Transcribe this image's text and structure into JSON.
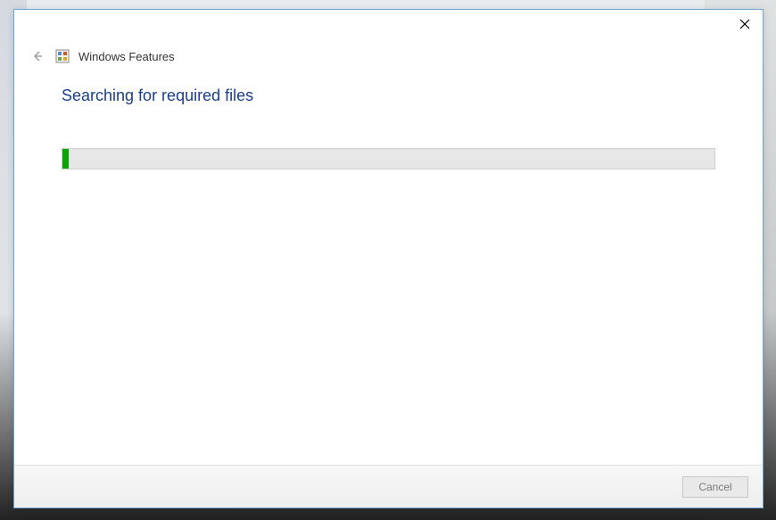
{
  "header": {
    "app_title": "Windows Features"
  },
  "content": {
    "status": "Searching for required files",
    "progress_percent": 1
  },
  "footer": {
    "cancel_label": "Cancel"
  },
  "colors": {
    "accent": "#1a3f8c",
    "progress_fill": "#0aa504",
    "dialog_border": "#6ea4d4"
  }
}
